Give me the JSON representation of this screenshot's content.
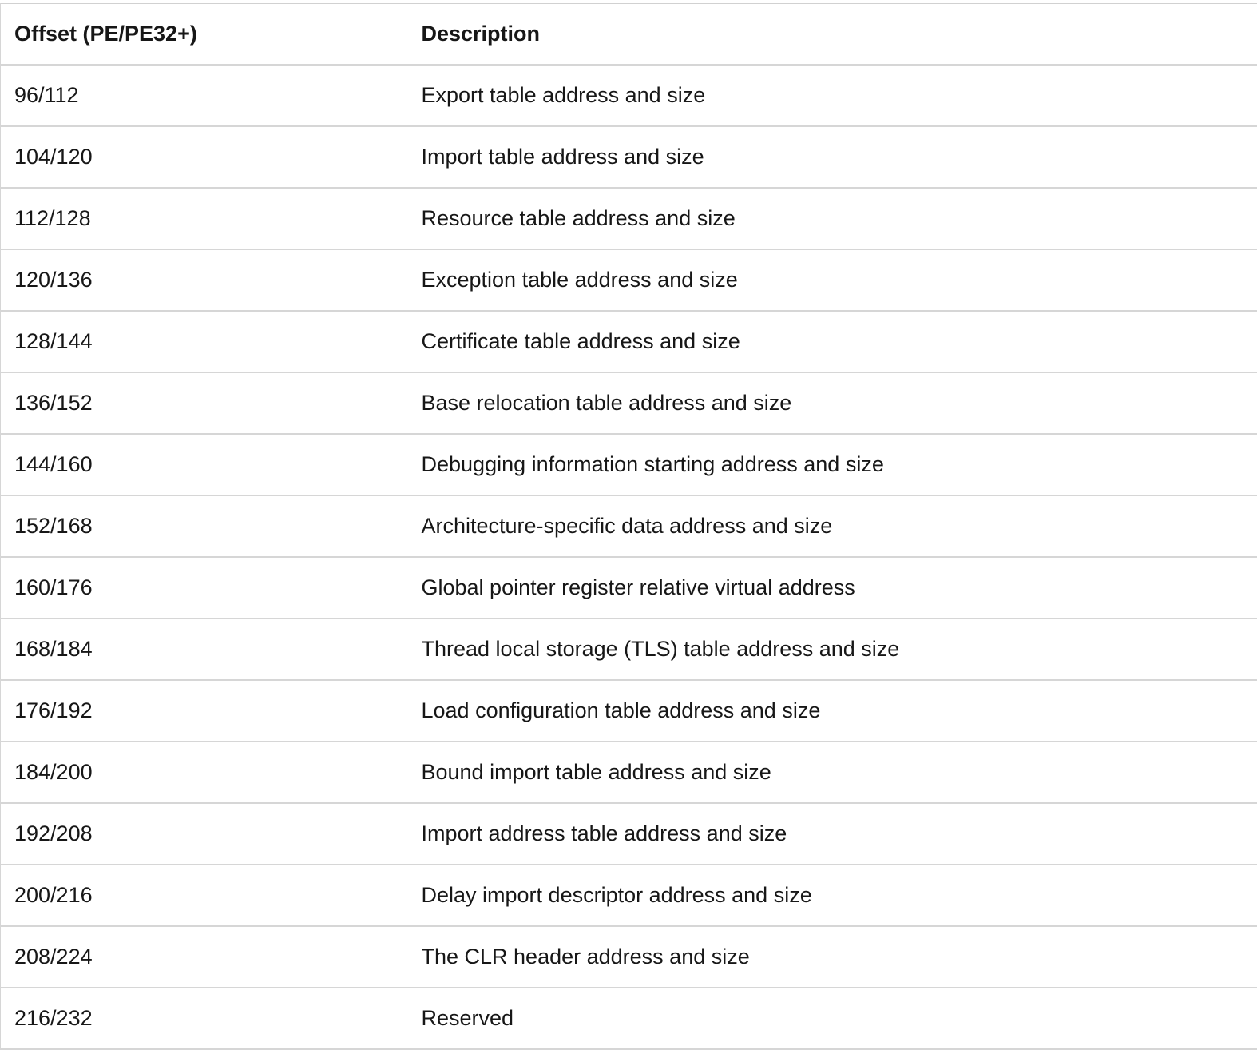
{
  "table": {
    "headers": [
      "Offset (PE/PE32+)",
      "Description"
    ],
    "rows": [
      {
        "offset": "96/112",
        "description": "Export table address and size"
      },
      {
        "offset": "104/120",
        "description": "Import table address and size"
      },
      {
        "offset": "112/128",
        "description": "Resource table address and size"
      },
      {
        "offset": "120/136",
        "description": "Exception table address and size"
      },
      {
        "offset": "128/144",
        "description": "Certificate table address and size"
      },
      {
        "offset": "136/152",
        "description": "Base relocation table address and size"
      },
      {
        "offset": "144/160",
        "description": "Debugging information starting address and size"
      },
      {
        "offset": "152/168",
        "description": "Architecture-specific data address and size"
      },
      {
        "offset": "160/176",
        "description": "Global pointer register relative virtual address"
      },
      {
        "offset": "168/184",
        "description": "Thread local storage (TLS) table address and size"
      },
      {
        "offset": "176/192",
        "description": "Load configuration table address and size"
      },
      {
        "offset": "184/200",
        "description": "Bound import table address and size"
      },
      {
        "offset": "192/208",
        "description": "Import address table address and size"
      },
      {
        "offset": "200/216",
        "description": "Delay import descriptor address and size"
      },
      {
        "offset": "208/224",
        "description": "The CLR header address and size"
      },
      {
        "offset": "216/232",
        "description": "Reserved"
      }
    ]
  }
}
